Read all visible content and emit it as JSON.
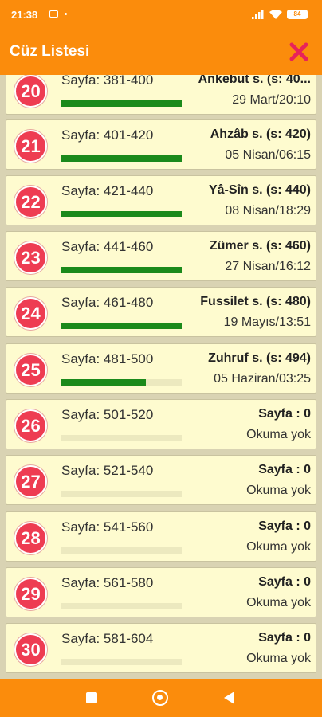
{
  "status_bar": {
    "time": "21:38",
    "battery": "84"
  },
  "app_bar": {
    "title": "Cüz Listesi"
  },
  "colors": {
    "accent": "#fb8c0c",
    "badge": "#ee3c52",
    "progress": "#1b8a1b",
    "card": "#fefbcf"
  },
  "juz_list": [
    {
      "number": "20",
      "pages": "Sayfa: 381-400",
      "status": "Ankebut s. (s: 40...",
      "date": "29 Mart/20:10",
      "progress": 1.0
    },
    {
      "number": "21",
      "pages": "Sayfa: 401-420",
      "status": "Ahzâb s. (s: 420)",
      "date": "05 Nisan/06:15",
      "progress": 1.0
    },
    {
      "number": "22",
      "pages": "Sayfa: 421-440",
      "status": "Yâ-Sîn s. (s: 440)",
      "date": "08 Nisan/18:29",
      "progress": 1.0
    },
    {
      "number": "23",
      "pages": "Sayfa: 441-460",
      "status": "Zümer s. (s: 460)",
      "date": "27 Nisan/16:12",
      "progress": 1.0
    },
    {
      "number": "24",
      "pages": "Sayfa: 461-480",
      "status": "Fussilet s. (s: 480)",
      "date": "19 Mayıs/13:51",
      "progress": 1.0
    },
    {
      "number": "25",
      "pages": "Sayfa: 481-500",
      "status": "Zuhruf s. (s: 494)",
      "date": "05 Haziran/03:25",
      "progress": 0.7
    },
    {
      "number": "26",
      "pages": "Sayfa: 501-520",
      "status": "Sayfa : 0",
      "date": "Okuma yok",
      "progress": 0
    },
    {
      "number": "27",
      "pages": "Sayfa: 521-540",
      "status": "Sayfa : 0",
      "date": "Okuma yok",
      "progress": 0
    },
    {
      "number": "28",
      "pages": "Sayfa: 541-560",
      "status": "Sayfa : 0",
      "date": "Okuma yok",
      "progress": 0
    },
    {
      "number": "29",
      "pages": "Sayfa: 561-580",
      "status": "Sayfa : 0",
      "date": "Okuma yok",
      "progress": 0
    },
    {
      "number": "30",
      "pages": "Sayfa: 581-604",
      "status": "Sayfa : 0",
      "date": "Okuma yok",
      "progress": 0
    }
  ]
}
